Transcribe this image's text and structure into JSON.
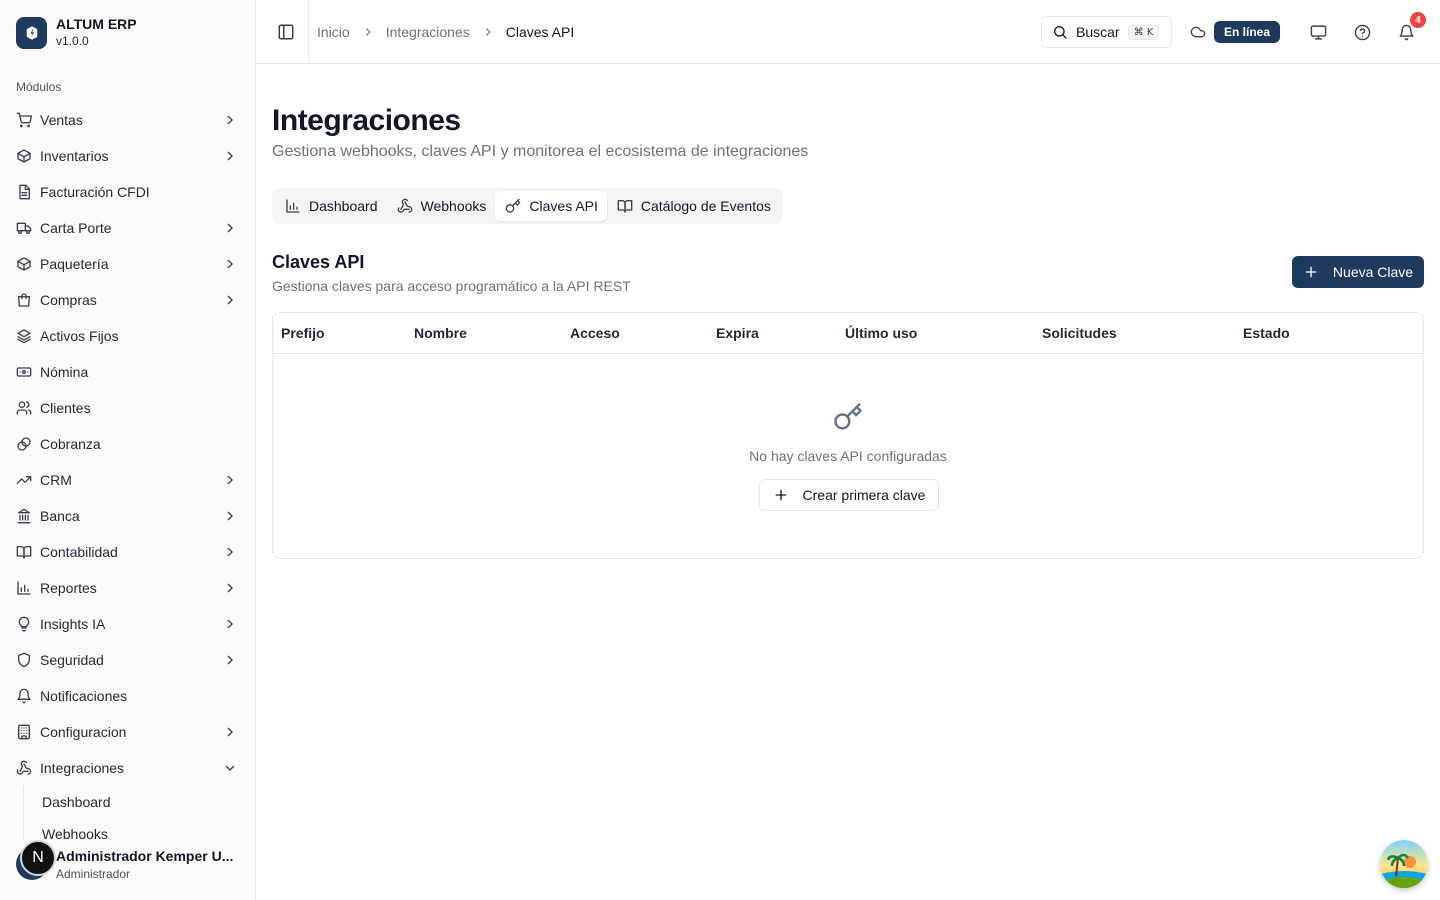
{
  "brand": {
    "title": "ALTUM ERP",
    "version": "v1.0.0"
  },
  "sidebar": {
    "section_label": "Módulos",
    "items": [
      {
        "label": "Ventas",
        "icon": "shopping-cart-icon",
        "chevron": "right"
      },
      {
        "label": "Inventarios",
        "icon": "package-icon",
        "chevron": "right"
      },
      {
        "label": "Facturación CFDI",
        "icon": "receipt-icon",
        "chevron": ""
      },
      {
        "label": "Carta Porte",
        "icon": "truck-icon",
        "chevron": "right"
      },
      {
        "label": "Paquetería",
        "icon": "package-icon",
        "chevron": "right"
      },
      {
        "label": "Compras",
        "icon": "shopping-bag-icon",
        "chevron": "right"
      },
      {
        "label": "Activos Fijos",
        "icon": "layers-icon",
        "chevron": ""
      },
      {
        "label": "Nómina",
        "icon": "banknote-icon",
        "chevron": ""
      },
      {
        "label": "Clientes",
        "icon": "users-icon",
        "chevron": ""
      },
      {
        "label": "Cobranza",
        "icon": "hand-coins-icon",
        "chevron": ""
      },
      {
        "label": "CRM",
        "icon": "trending-up-icon",
        "chevron": "right"
      },
      {
        "label": "Banca",
        "icon": "landmark-icon",
        "chevron": "right"
      },
      {
        "label": "Contabilidad",
        "icon": "book-open-icon",
        "chevron": "right"
      },
      {
        "label": "Reportes",
        "icon": "bar-chart-icon",
        "chevron": "right"
      },
      {
        "label": "Insights IA",
        "icon": "lightbulb-icon",
        "chevron": "right"
      },
      {
        "label": "Seguridad",
        "icon": "shield-icon",
        "chevron": "right"
      },
      {
        "label": "Notificaciones",
        "icon": "bell-icon",
        "chevron": ""
      },
      {
        "label": "Configuracion",
        "icon": "building-icon",
        "chevron": "right"
      },
      {
        "label": "Integraciones",
        "icon": "webhook-icon",
        "chevron": "down"
      }
    ],
    "sub_items": [
      "Dashboard",
      "Webhooks"
    ]
  },
  "user": {
    "initial": "N",
    "name": "Administrador Kemper U...",
    "role": "Administrador"
  },
  "header": {
    "breadcrumb": [
      "Inicio",
      "Integraciones",
      "Claves API"
    ],
    "search_label": "Buscar",
    "search_kbd": "⌘ K",
    "status": "En línea",
    "notification_count": "4"
  },
  "main": {
    "title": "Integraciones",
    "subtitle": "Gestiona webhooks, claves API y monitorea el ecosistema de integraciones",
    "tabs": [
      {
        "label": "Dashboard",
        "icon": "bar-chart-icon"
      },
      {
        "label": "Webhooks",
        "icon": "webhook-icon"
      },
      {
        "label": "Claves API",
        "icon": "key-icon"
      },
      {
        "label": "Catálogo de Eventos",
        "icon": "book-open-icon"
      }
    ],
    "active_tab": "Claves API",
    "section_title": "Claves API",
    "section_subtitle": "Gestiona claves para acceso programático a la API REST",
    "new_button": "Nueva Clave",
    "table": {
      "columns": [
        "Prefijo",
        "Nombre",
        "Acceso",
        "Expira",
        "Último uso",
        "Solicitudes",
        "Estado"
      ],
      "empty_text": "No hay claves API configuradas",
      "empty_button": "Crear primera clave"
    }
  },
  "colors": {
    "primary": "#1e3a5f",
    "badge": "#ef4444",
    "muted": "#6b7280",
    "border": "#e5e7eb"
  }
}
